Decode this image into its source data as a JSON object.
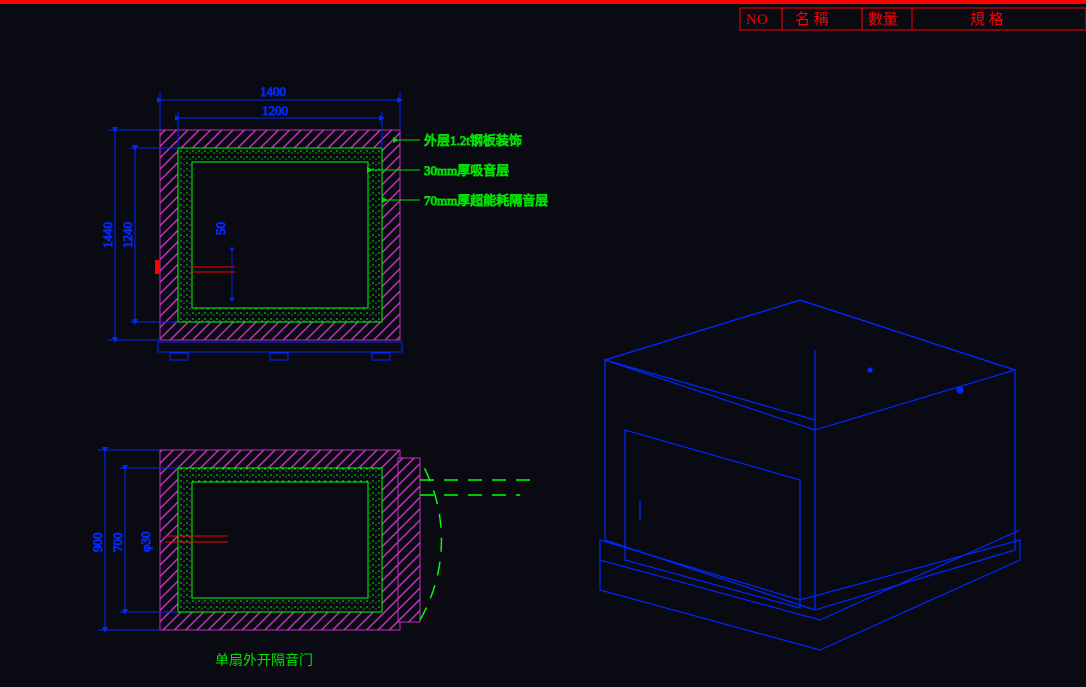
{
  "header": {
    "col_no": "NO",
    "col_name": "名 稱",
    "col_qty": "數量",
    "col_spec": "規 格"
  },
  "dimensions": {
    "top_outer_w": "1400",
    "top_inner_w": "1200",
    "top_outer_h": "1440",
    "top_inner_h": "1240",
    "top_slot": "50",
    "bot_outer_h": "900",
    "bot_inner_h": "700",
    "bot_dia": "φ30"
  },
  "labels": {
    "layer1": "外层1.2t钢板装饰",
    "layer2": "30mm厚吸音层",
    "layer3": "70mm厚超能耗隔音层",
    "door_title": "单扇外开隔音门"
  },
  "colors": {
    "red": "#ff0000",
    "blue": "#0028ff",
    "green": "#00ff00",
    "magenta": "#c030c0",
    "text_green": "#00e000"
  }
}
